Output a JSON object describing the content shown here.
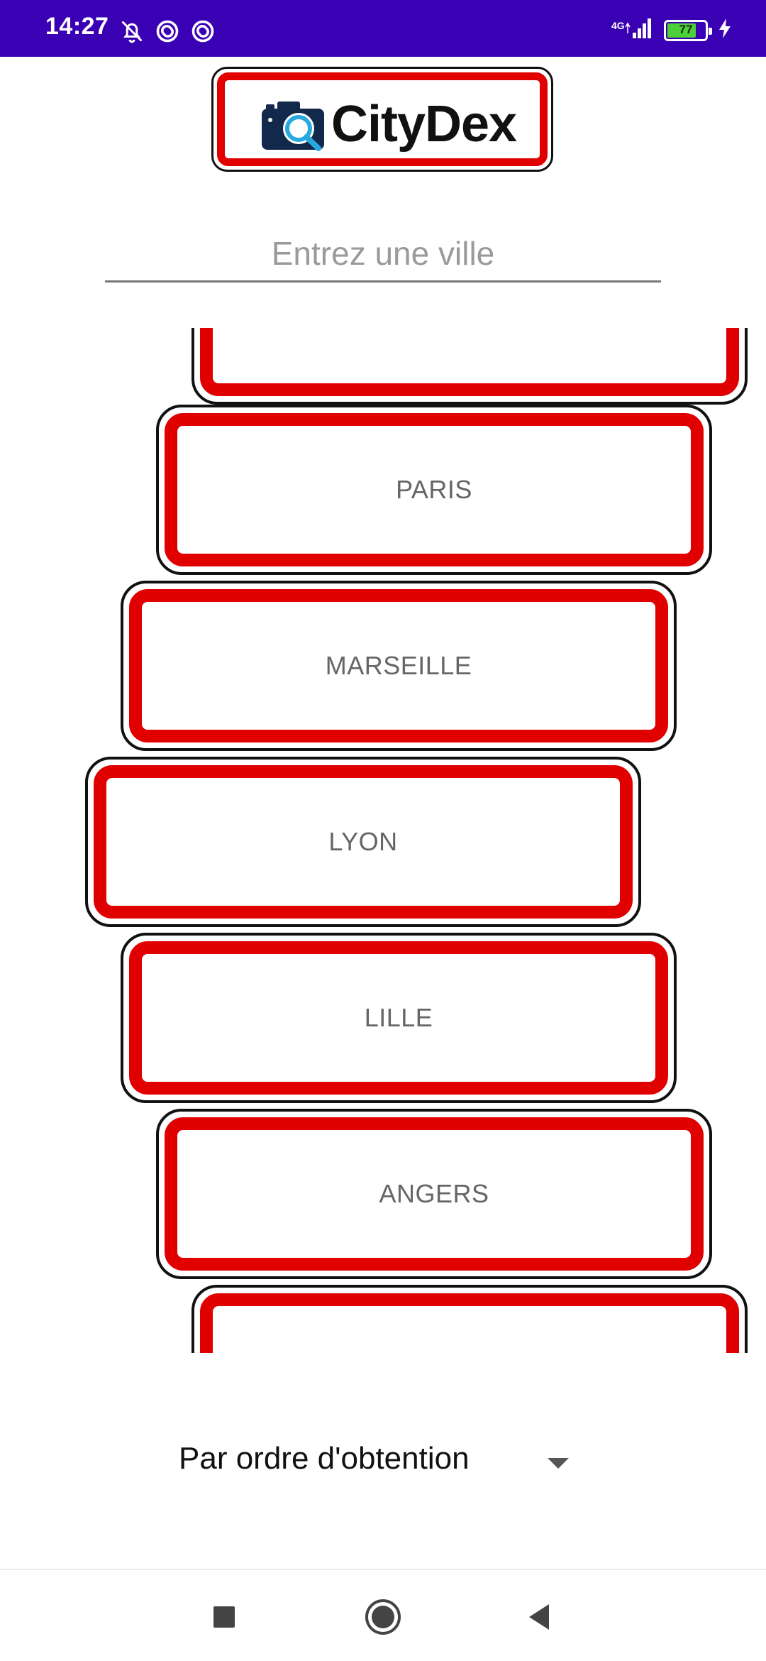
{
  "status_bar": {
    "time": "14:27",
    "network": "4G",
    "battery_level": "77",
    "battery_fraction": 0.77,
    "icons": [
      "bell-off-icon",
      "sync-icon",
      "sync-icon",
      "signal-icon",
      "battery-icon",
      "charging-icon"
    ]
  },
  "logo": {
    "text": "CityDex",
    "icon": "camera-search-icon"
  },
  "search": {
    "placeholder": "Entrez une ville",
    "value": ""
  },
  "cities": [
    {
      "name": ""
    },
    {
      "name": "PARIS"
    },
    {
      "name": "MARSEILLE"
    },
    {
      "name": "LYON"
    },
    {
      "name": "LILLE"
    },
    {
      "name": "ANGERS"
    },
    {
      "name": ""
    }
  ],
  "sort": {
    "selected": "Par ordre d'obtention"
  },
  "nav": {
    "buttons": [
      "recents-icon",
      "home-icon",
      "back-icon"
    ]
  },
  "colors": {
    "status_bar": "#3a00b3",
    "sign_red": "#e00000",
    "sign_border": "#111111",
    "city_text": "#666666",
    "battery_green": "#4cd137"
  }
}
